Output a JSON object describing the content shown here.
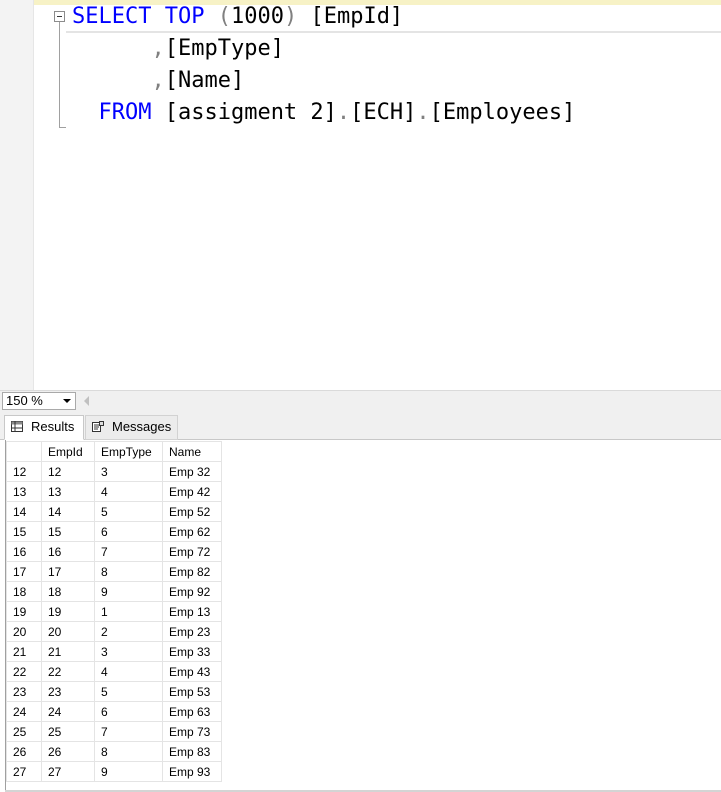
{
  "editor": {
    "lines": [
      {
        "tokens": [
          {
            "t": "SELECT",
            "c": "kw"
          },
          {
            "t": " ",
            "c": "id"
          },
          {
            "t": "TOP",
            "c": "kw"
          },
          {
            "t": " ",
            "c": "id"
          },
          {
            "t": "(",
            "c": "gr"
          },
          {
            "t": "1000",
            "c": "id"
          },
          {
            "t": ")",
            "c": "gr"
          },
          {
            "t": " [EmpId]",
            "c": "id"
          }
        ]
      },
      {
        "tokens": [
          {
            "t": "      ",
            "c": "id"
          },
          {
            "t": ",",
            "c": "gr"
          },
          {
            "t": "[EmpType]",
            "c": "id"
          }
        ]
      },
      {
        "tokens": [
          {
            "t": "      ",
            "c": "id"
          },
          {
            "t": ",",
            "c": "gr"
          },
          {
            "t": "[Name]",
            "c": "id"
          }
        ]
      },
      {
        "tokens": [
          {
            "t": "  ",
            "c": "id"
          },
          {
            "t": "FROM",
            "c": "kw"
          },
          {
            "t": " [assigment 2]",
            "c": "id"
          },
          {
            "t": ".",
            "c": "gr"
          },
          {
            "t": "[ECH]",
            "c": "id"
          },
          {
            "t": ".",
            "c": "gr"
          },
          {
            "t": "[Employees]",
            "c": "id"
          }
        ]
      }
    ]
  },
  "zoom": {
    "value": "150 %"
  },
  "tabs": [
    {
      "label": "Results",
      "icon": "grid-icon"
    },
    {
      "label": "Messages",
      "icon": "messages-icon"
    }
  ],
  "grid": {
    "columns": [
      "EmpId",
      "EmpType",
      "Name"
    ],
    "rows": [
      {
        "n": "12",
        "cells": [
          "12",
          "3",
          "Emp 32"
        ]
      },
      {
        "n": "13",
        "cells": [
          "13",
          "4",
          "Emp 42"
        ]
      },
      {
        "n": "14",
        "cells": [
          "14",
          "5",
          "Emp 52"
        ]
      },
      {
        "n": "15",
        "cells": [
          "15",
          "6",
          "Emp 62"
        ]
      },
      {
        "n": "16",
        "cells": [
          "16",
          "7",
          "Emp 72"
        ]
      },
      {
        "n": "17",
        "cells": [
          "17",
          "8",
          "Emp 82"
        ]
      },
      {
        "n": "18",
        "cells": [
          "18",
          "9",
          "Emp 92"
        ]
      },
      {
        "n": "19",
        "cells": [
          "19",
          "1",
          "Emp 13"
        ]
      },
      {
        "n": "20",
        "cells": [
          "20",
          "2",
          "Emp 23"
        ]
      },
      {
        "n": "21",
        "cells": [
          "21",
          "3",
          "Emp 33"
        ]
      },
      {
        "n": "22",
        "cells": [
          "22",
          "4",
          "Emp 43"
        ]
      },
      {
        "n": "23",
        "cells": [
          "23",
          "5",
          "Emp 53"
        ]
      },
      {
        "n": "24",
        "cells": [
          "24",
          "6",
          "Emp 63"
        ]
      },
      {
        "n": "25",
        "cells": [
          "25",
          "7",
          "Emp 73"
        ]
      },
      {
        "n": "26",
        "cells": [
          "26",
          "8",
          "Emp 83"
        ]
      },
      {
        "n": "27",
        "cells": [
          "27",
          "9",
          "Emp 93"
        ]
      }
    ]
  },
  "colors": {
    "keyword": "#0000ff",
    "punctuation": "#808080",
    "text": "#000000"
  }
}
